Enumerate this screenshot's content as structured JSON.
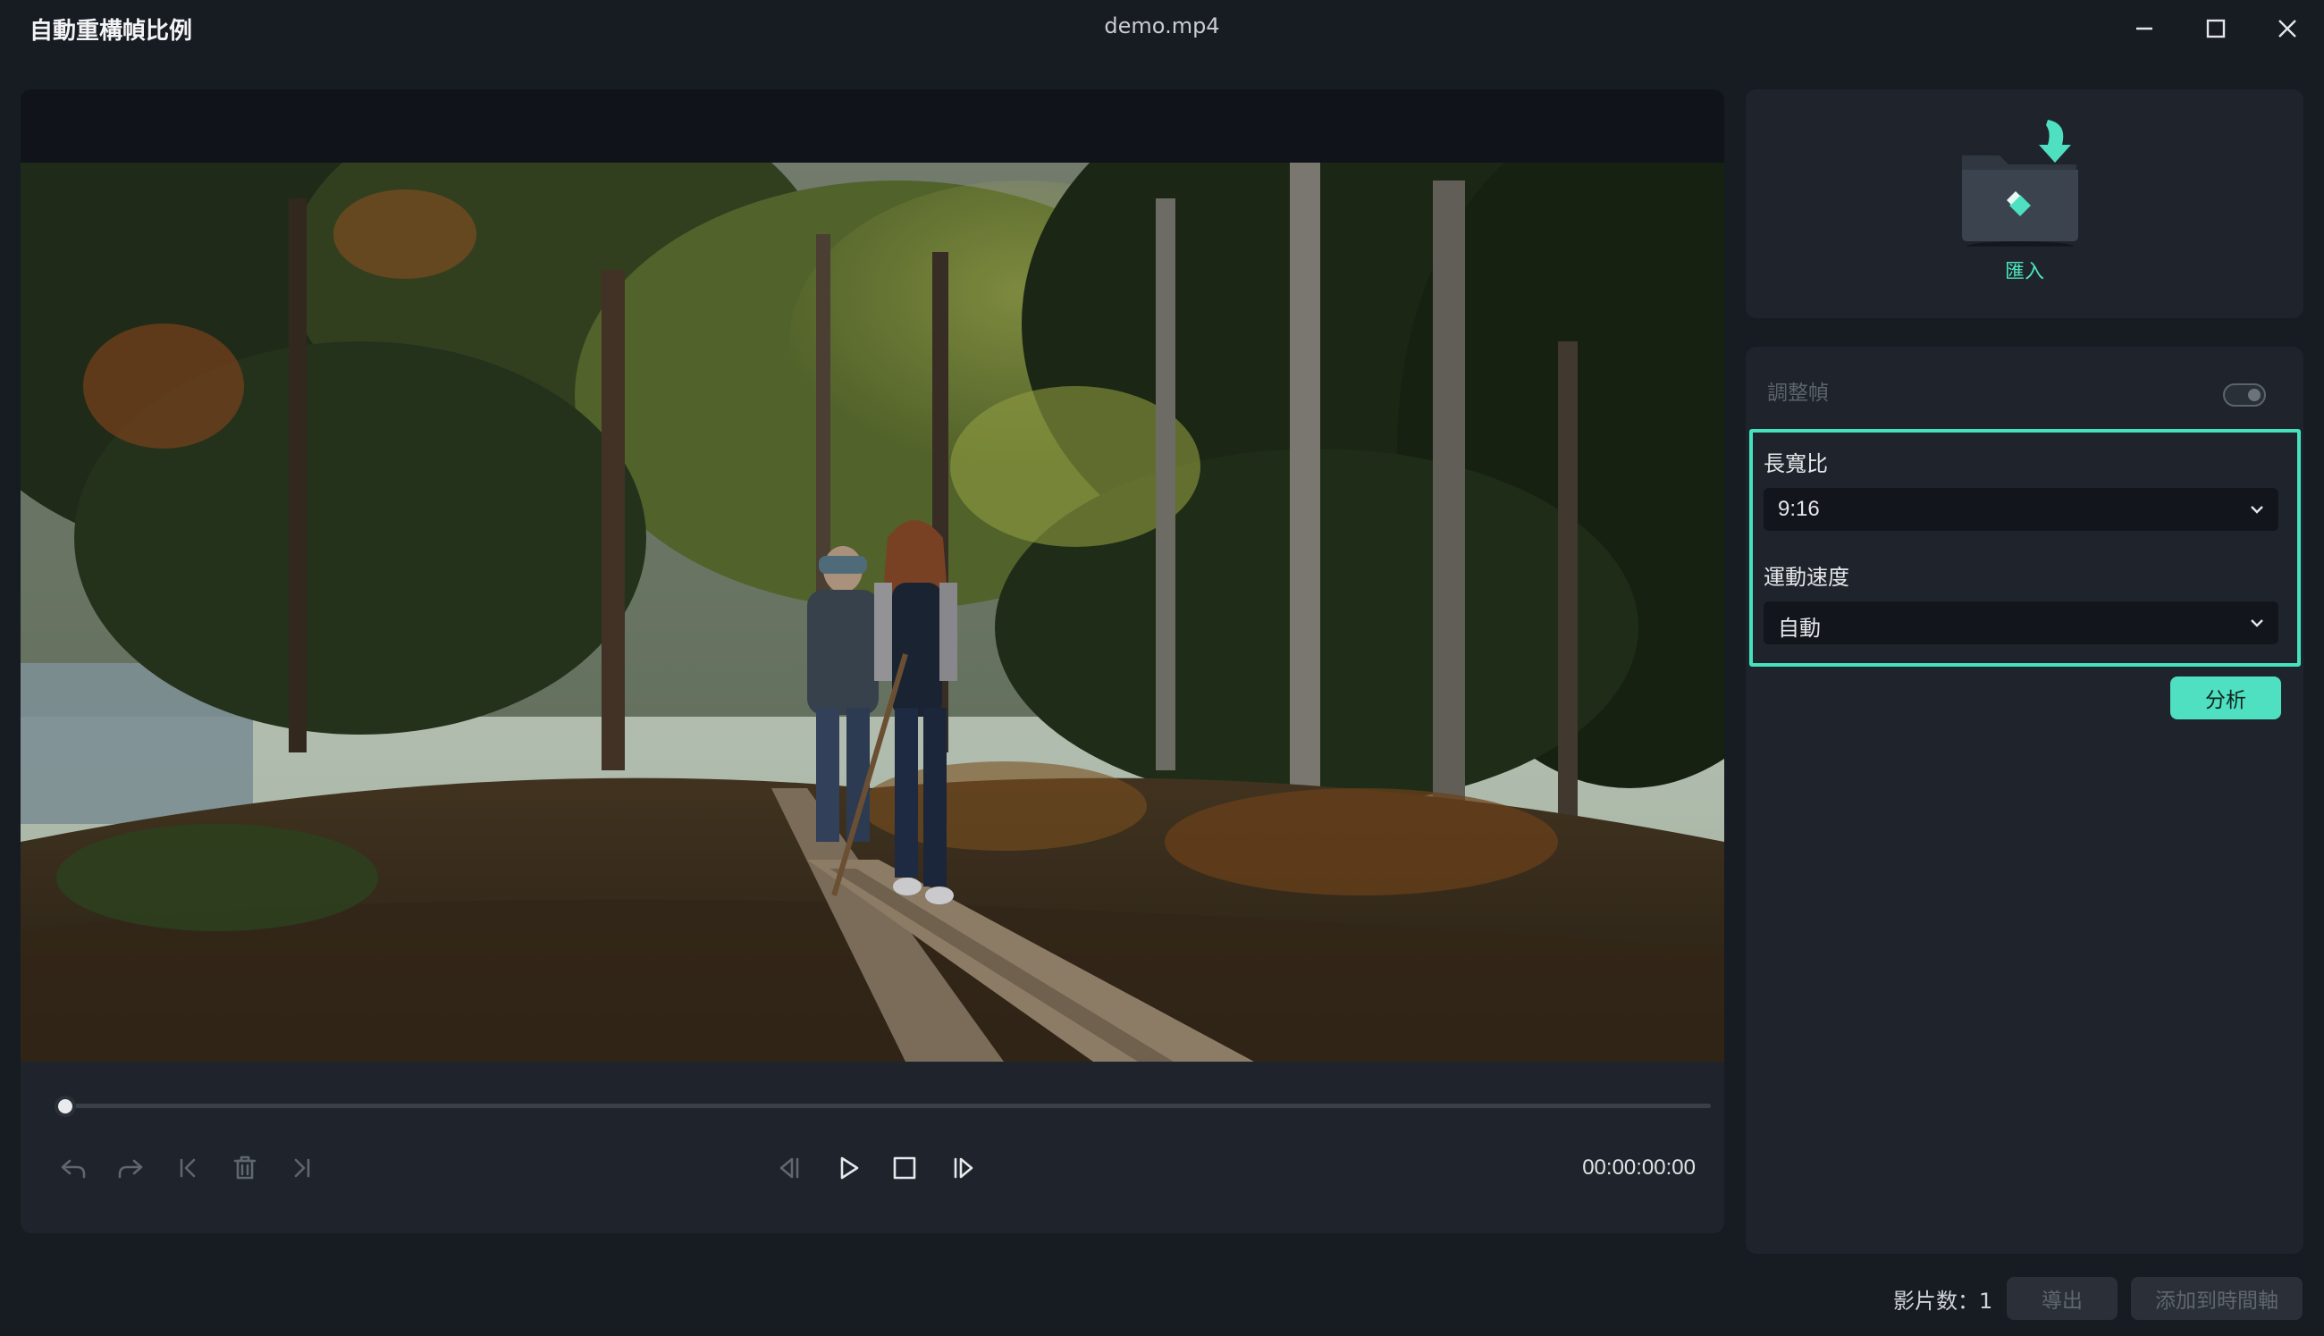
{
  "window": {
    "app_title": "自動重構幀比例",
    "file_name": "demo.mp4",
    "controls": [
      "minimize-icon",
      "maximize-icon",
      "close-icon"
    ]
  },
  "player": {
    "timecode": "00:00:00:00",
    "progress": 0,
    "left_controls": [
      "undo-icon",
      "redo-icon",
      "go-to-start-icon",
      "delete-icon",
      "go-to-end-icon"
    ],
    "center_controls": [
      "previous-frame-icon",
      "play-icon",
      "stop-icon",
      "next-frame-icon"
    ]
  },
  "import_panel": {
    "label": "匯入"
  },
  "settings": {
    "adjust_frame_label": "調整幀",
    "adjust_frame_enabled": false,
    "aspect_ratio_label": "長寬比",
    "aspect_ratio_value": "9:16",
    "motion_speed_label": "運動速度",
    "motion_speed_value": "自動",
    "analyze_button": "分析"
  },
  "footer": {
    "clip_count": "影片数：1",
    "export_button": "導出",
    "add_to_timeline_button": "添加到時間軸"
  },
  "colors": {
    "accent": "#4ee0c0",
    "background": "#171b22",
    "panel": "#1f242c"
  }
}
